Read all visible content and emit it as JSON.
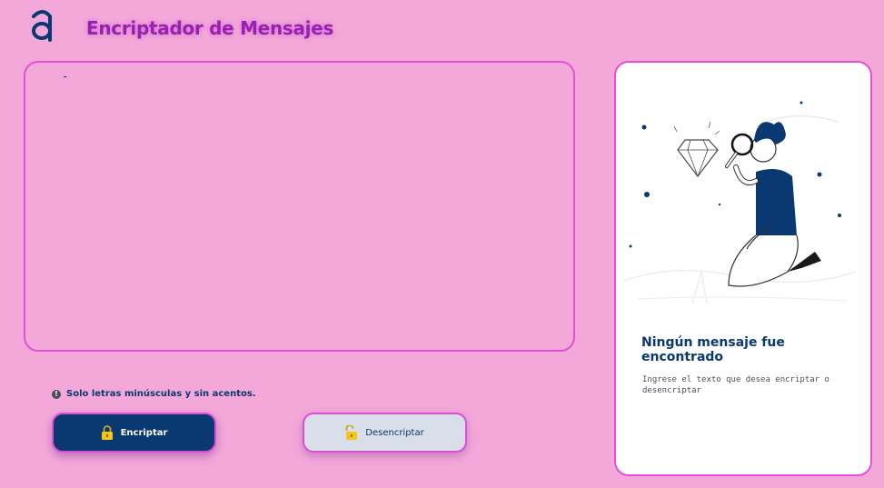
{
  "header": {
    "logo_icon": "alura-logo-icon",
    "title": "Encriptador de Mensajes"
  },
  "editor": {
    "value": "-",
    "placeholder": ""
  },
  "hint": {
    "icon": "info-icon",
    "text": "Solo letras minúsculas y sin acentos."
  },
  "buttons": {
    "encrypt_label": "Encriptar",
    "encrypt_icon": "lock-icon",
    "decrypt_label": "Desencriptar",
    "decrypt_icon": "unlock-icon"
  },
  "result": {
    "illustration": "person-with-magnifying-glass-and-diamond-illustration",
    "title": "Ningún mensaje fue encontrado",
    "description": "Ingrese el texto que desea encriptar o desencriptar"
  },
  "colors": {
    "background": "#f4a8d9",
    "primary": "#0a3871",
    "accent_border": "#e44fd6",
    "title": "#9b1fb0"
  }
}
